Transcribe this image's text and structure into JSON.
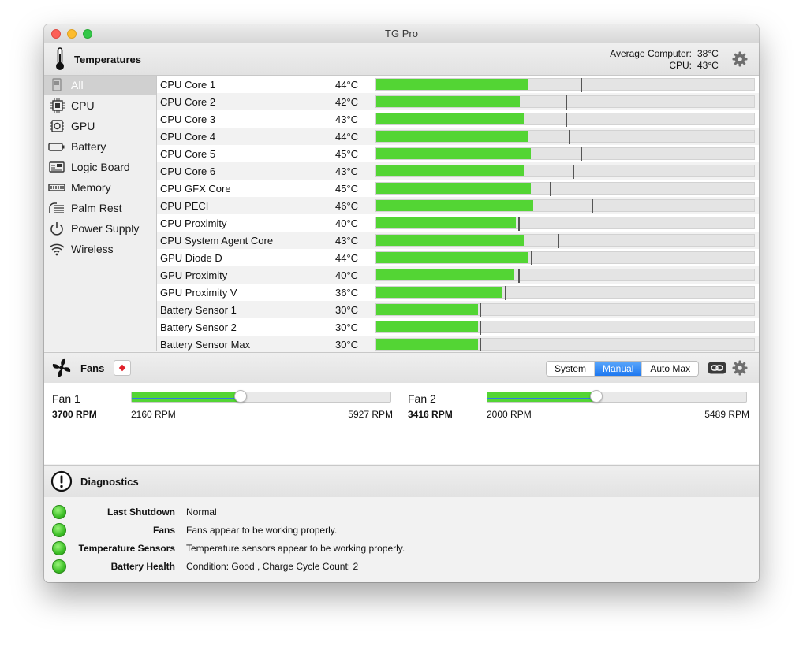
{
  "window": {
    "title": "TG Pro"
  },
  "temperatures": {
    "title": "Temperatures",
    "average_label": "Average Computer:",
    "average_value": "38°C",
    "cpu_label": "CPU:",
    "cpu_value": "43°C"
  },
  "sidebar": {
    "items": [
      {
        "label": "All",
        "icon": "computer-icon",
        "selected": true
      },
      {
        "label": "CPU",
        "icon": "cpu-chip-icon"
      },
      {
        "label": "GPU",
        "icon": "gpu-chip-icon"
      },
      {
        "label": "Battery",
        "icon": "battery-icon"
      },
      {
        "label": "Logic Board",
        "icon": "logic-board-icon"
      },
      {
        "label": "Memory",
        "icon": "memory-icon"
      },
      {
        "label": "Palm Rest",
        "icon": "palm-rest-icon"
      },
      {
        "label": "Power Supply",
        "icon": "power-icon"
      },
      {
        "label": "Wireless",
        "icon": "wifi-icon"
      }
    ]
  },
  "sensors": [
    {
      "name": "CPU Core 1",
      "temp": "44°C",
      "fill": 0.4,
      "max": 0.54
    },
    {
      "name": "CPU Core 2",
      "temp": "42°C",
      "fill": 0.38,
      "max": 0.5
    },
    {
      "name": "CPU Core 3",
      "temp": "43°C",
      "fill": 0.39,
      "max": 0.5
    },
    {
      "name": "CPU Core 4",
      "temp": "44°C",
      "fill": 0.4,
      "max": 0.51
    },
    {
      "name": "CPU Core 5",
      "temp": "45°C",
      "fill": 0.41,
      "max": 0.54
    },
    {
      "name": "CPU Core 6",
      "temp": "43°C",
      "fill": 0.39,
      "max": 0.52
    },
    {
      "name": "CPU GFX Core",
      "temp": "45°C",
      "fill": 0.41,
      "max": 0.46
    },
    {
      "name": "CPU PECI",
      "temp": "46°C",
      "fill": 0.415,
      "max": 0.57
    },
    {
      "name": "CPU Proximity",
      "temp": "40°C",
      "fill": 0.37,
      "max": 0.375
    },
    {
      "name": "CPU System Agent Core",
      "temp": "43°C",
      "fill": 0.39,
      "max": 0.48
    },
    {
      "name": "GPU Diode D",
      "temp": "44°C",
      "fill": 0.4,
      "max": 0.41
    },
    {
      "name": "GPU Proximity",
      "temp": "40°C",
      "fill": 0.365,
      "max": 0.375
    },
    {
      "name": "GPU Proximity V",
      "temp": "36°C",
      "fill": 0.335,
      "max": 0.34
    },
    {
      "name": "Battery Sensor 1",
      "temp": "30°C",
      "fill": 0.27,
      "max": 0.273
    },
    {
      "name": "Battery Sensor 2",
      "temp": "30°C",
      "fill": 0.27,
      "max": 0.273
    },
    {
      "name": "Battery Sensor Max",
      "temp": "30°C",
      "fill": 0.27,
      "max": 0.273
    }
  ],
  "fans": {
    "title": "Fans",
    "modes": [
      "System",
      "Manual",
      "Auto Max"
    ],
    "active_mode": "Manual",
    "items": [
      {
        "name": "Fan 1",
        "rpm": "3700 RPM",
        "min": "2160 RPM",
        "max": "5927 RPM",
        "level": 0.42
      },
      {
        "name": "Fan 2",
        "rpm": "3416 RPM",
        "min": "2000 RPM",
        "max": "5489 RPM",
        "level": 0.42
      }
    ]
  },
  "diagnostics": {
    "title": "Diagnostics",
    "items": [
      {
        "label": "Last Shutdown",
        "value": "Normal",
        "status": "ok"
      },
      {
        "label": "Fans",
        "value": "Fans appear to be working properly.",
        "status": "ok"
      },
      {
        "label": "Temperature Sensors",
        "value": "Temperature sensors appear to be working properly.",
        "status": "ok"
      },
      {
        "label": "Battery Health",
        "value": "Condition: Good , Charge Cycle Count: 2",
        "status": "ok"
      }
    ]
  },
  "colors": {
    "bar_green": "#53d534",
    "accent_blue": "#1e78f0",
    "status_ok": "#3cbf26"
  }
}
